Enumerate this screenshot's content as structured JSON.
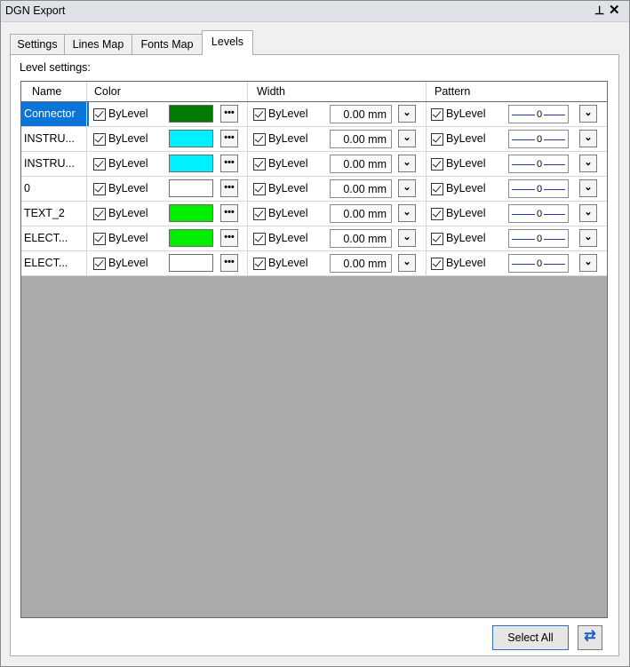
{
  "window": {
    "title": "DGN Export"
  },
  "tabs": [
    {
      "label": "Settings"
    },
    {
      "label": "Lines Map"
    },
    {
      "label": "Fonts Map"
    },
    {
      "label": "Levels"
    }
  ],
  "active_tab": "Levels",
  "section_label": "Level settings:",
  "columns": {
    "name": "Name",
    "color": "Color",
    "width": "Width",
    "pattern": "Pattern"
  },
  "rows": [
    {
      "name": "Connector",
      "bylevel": "ByLevel",
      "color_hex": "#007a00",
      "width_value": "0.00 mm",
      "pattern_value": "0",
      "selected": true
    },
    {
      "name": "INSTRU...",
      "bylevel": "ByLevel",
      "color_hex": "#00f0ff",
      "width_value": "0.00 mm",
      "pattern_value": "0"
    },
    {
      "name": "INSTRU...",
      "bylevel": "ByLevel",
      "color_hex": "#00f0ff",
      "width_value": "0.00 mm",
      "pattern_value": "0"
    },
    {
      "name": "0",
      "bylevel": "ByLevel",
      "color_hex": "#ffffff",
      "width_value": "0.00 mm",
      "pattern_value": "0"
    },
    {
      "name": "TEXT_2",
      "bylevel": "ByLevel",
      "color_hex": "#00ee00",
      "width_value": "0.00 mm",
      "pattern_value": "0"
    },
    {
      "name": "ELECT...",
      "bylevel": "ByLevel",
      "color_hex": "#00ee00",
      "width_value": "0.00 mm",
      "pattern_value": "0"
    },
    {
      "name": "ELECT...",
      "bylevel": "ByLevel",
      "color_hex": "#ffffff",
      "width_value": "0.00 mm",
      "pattern_value": "0"
    }
  ],
  "footer": {
    "select_all": "Select All"
  },
  "icons": {
    "pin": "pin-icon",
    "close": "close-icon",
    "ellipsis": "ellipsis-icon",
    "dropdown": "chevron-down-icon",
    "refresh": "refresh-icon"
  }
}
